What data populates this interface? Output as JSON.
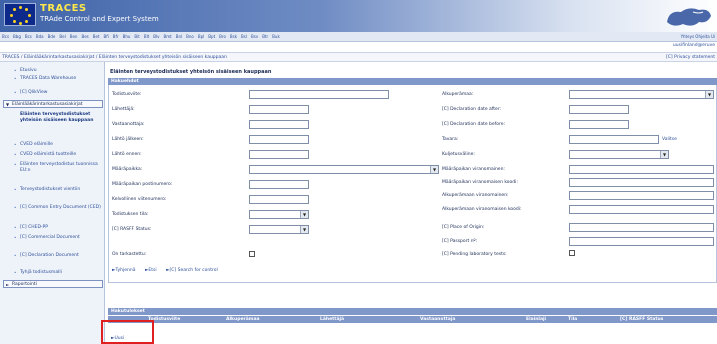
{
  "header": {
    "title": "TRACES",
    "subtitle": "TRAde Control and Expert System"
  },
  "langbar": {
    "langs": [
      "Bcs",
      "Bbg",
      "Bcs",
      "Bda",
      "Bde",
      "Bel",
      "Ben",
      "Bes",
      "Bet",
      "Bfi",
      "Bfr",
      "Bhu",
      "Bit",
      "Blt",
      "Blv",
      "Bmt",
      "Bnl",
      "Bno",
      "Bpl",
      "Bpt",
      "Bro",
      "Bsk",
      "Bsl",
      "Bsv",
      "Btr",
      "Buk"
    ],
    "topright": "Yhteys Ohjeita Ui"
  },
  "user": {
    "name": "uusifinland@eruve"
  },
  "breadcrumb": {
    "path": "TRACES / Eläinlääkärintarkastusasiakirjat / Eläinten terveystodistukset yhteisön sisäiseen kauppaan",
    "privacy": "[C] Privacy statement"
  },
  "sidebar": {
    "items_top": [
      "Etusivu",
      "TRACES Data Warehouse",
      "[C] QlikView"
    ],
    "section1": "Eläinlääkärintarkastusasiakirjat",
    "items_mid": [
      {
        "label": "Eläinten terveystodistukset yhteisön sisäiseen kauppaan",
        "active": true
      },
      {
        "label": "CVED eläimille",
        "active": false
      },
      {
        "label": "CVED eläimistä tuotteille",
        "active": false
      },
      {
        "label": "Eläinten terveystodistus tuonnissa EU:n",
        "active": false
      },
      {
        "label": "Terveystodistukset vientiin",
        "active": false
      },
      {
        "label": "[C] Common Entry Document (CED)",
        "active": false
      },
      {
        "label": "[C] CHED-PP",
        "active": false
      },
      {
        "label": "[C] Commercial Document",
        "active": false
      },
      {
        "label": "[C] Declaration Document",
        "active": false
      },
      {
        "label": "Tyhjä todistusmalli",
        "active": false
      }
    ],
    "section2": "Raportointi"
  },
  "page": {
    "title": "Eläinten terveystodistukset yhteisön sisäiseen kauppaan",
    "search_header": "Hakuehdot",
    "results_header": "Hakutulokset"
  },
  "form": {
    "left": [
      {
        "label": "Todistusviite:",
        "type": "input"
      },
      {
        "label": "Lähettäjä:",
        "type": "input"
      },
      {
        "label": "Vastaanottaja:",
        "type": "input"
      },
      {
        "label": "Lähtö jälkeen:",
        "type": "input"
      },
      {
        "label": "Lähtö ennen:",
        "type": "input"
      },
      {
        "label": "Määräpaikka:",
        "type": "select"
      },
      {
        "label": "Määräpaikan postinumero:",
        "type": "input"
      },
      {
        "label": "Kelvollinen viitenumero:",
        "type": "input"
      },
      {
        "label": "Todistuksen tila:",
        "type": "select"
      },
      {
        "label": "[C] RASFF Status:",
        "type": "select"
      }
    ],
    "right": [
      {
        "label": "Alkuperämaa:",
        "type": "select"
      },
      {
        "label": "[C] Declaration date after:",
        "type": "input"
      },
      {
        "label": "[C] Declaration date before:",
        "type": "input"
      },
      {
        "label": "Tavara:",
        "type": "input",
        "link": "Valitse"
      },
      {
        "label": "Kuljetusväline:",
        "type": "select"
      },
      {
        "label": "Määräpaikan viranomainen:",
        "type": "input"
      },
      {
        "label": "Määräpaikan viranomaisen koodi:",
        "type": "input"
      },
      {
        "label": "Alkuperämaan viranomainen:",
        "type": "input"
      },
      {
        "label": "Alkuperämaan viranomaisen koodi:",
        "type": "input"
      },
      {
        "label": "[C] Place of Origin:",
        "type": "input"
      },
      {
        "label": "[C] Passport nº:",
        "type": "input"
      },
      {
        "label": "[C] Pending laboratory tests:",
        "type": "checkbox"
      }
    ],
    "on_tarkastettu": "On tarkastettu:",
    "actions": [
      "Tyhjennä",
      "Etsi",
      "[C] Search for control"
    ]
  },
  "results": {
    "columns": [
      "Todistusviite",
      "Alkuperämaa",
      "Lähettäjä",
      "Vastaanottaja",
      "Elainlaji",
      "Tila",
      "[C] RASFF Status"
    ]
  },
  "new_link": "Uusi"
}
